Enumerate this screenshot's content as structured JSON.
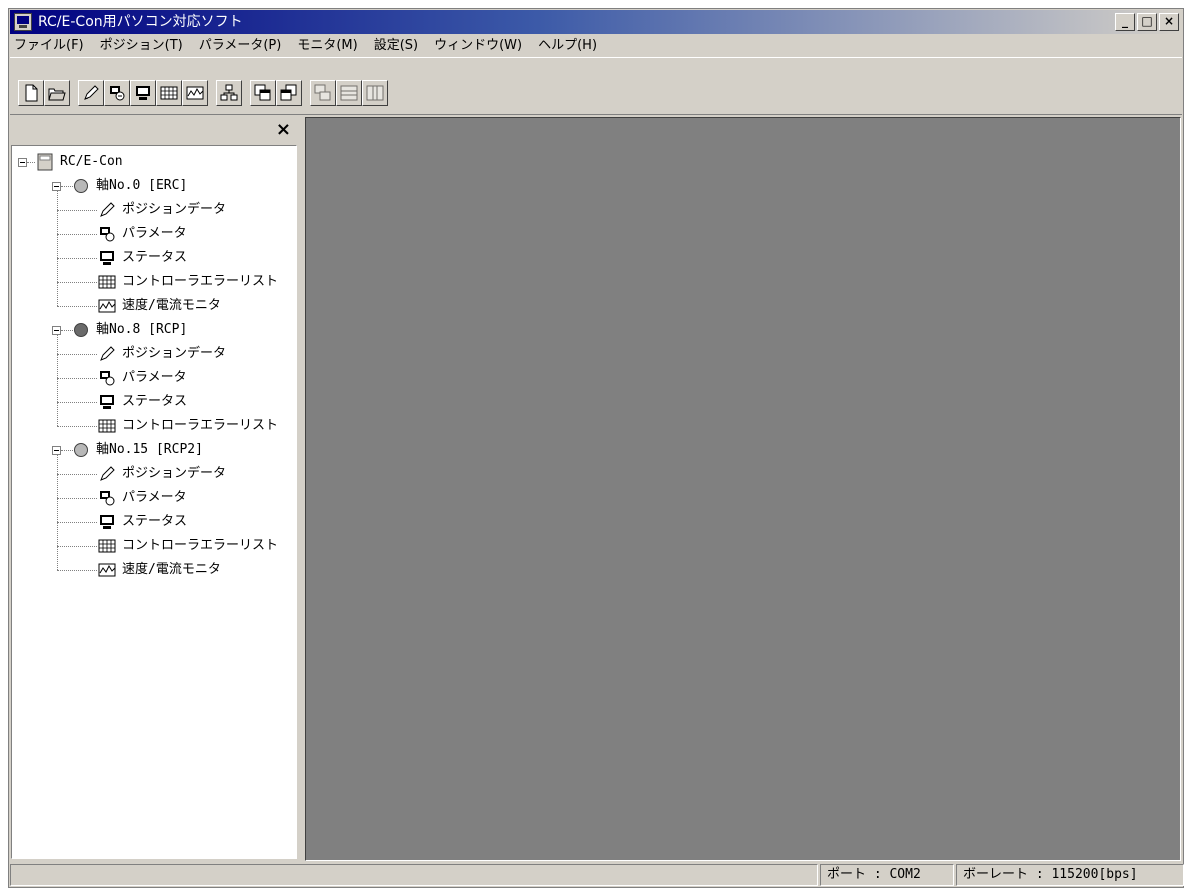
{
  "window": {
    "title": "RC/E-Con用パソコン対応ソフト",
    "min_glyph": "_",
    "max_glyph": "□",
    "close_glyph": "×"
  },
  "menu": [
    "ファイル(F)",
    "ポジション(T)",
    "パラメータ(P)",
    "モニタ(M)",
    "設定(S)",
    "ウィンドウ(W)",
    "ヘルプ(H)"
  ],
  "toolbar": {
    "buttons": [
      {
        "name": "new-file-icon",
        "enabled": true
      },
      {
        "name": "open-folder-icon",
        "enabled": true
      },
      {
        "name": "pencil-icon",
        "enabled": true
      },
      {
        "name": "parameter-icon",
        "enabled": true
      },
      {
        "name": "monitor-icon",
        "enabled": true
      },
      {
        "name": "error-list-icon",
        "enabled": true
      },
      {
        "name": "chart-icon",
        "enabled": true
      },
      {
        "name": "network-icon",
        "enabled": true
      },
      {
        "name": "copy-window-icon",
        "enabled": true
      },
      {
        "name": "paste-window-icon",
        "enabled": true
      },
      {
        "name": "cascade-icon",
        "enabled": false
      },
      {
        "name": "tile-horizontal-icon",
        "enabled": false
      },
      {
        "name": "tile-vertical-icon",
        "enabled": false
      }
    ]
  },
  "tree": {
    "close_glyph": "×",
    "root": "RC/E-Con",
    "axes": [
      {
        "label": "軸No.0 [ERC]",
        "color": "#b8b8b8",
        "children": [
          "ポジションデータ",
          "パラメータ",
          "ステータス",
          "コントローラエラーリスト",
          "速度/電流モニタ"
        ]
      },
      {
        "label": "軸No.8 [RCP]",
        "color": "#6a6a6a",
        "children": [
          "ポジションデータ",
          "パラメータ",
          "ステータス",
          "コントローラエラーリスト"
        ]
      },
      {
        "label": "軸No.15 [RCP2]",
        "color": "#b8b8b8",
        "children": [
          "ポジションデータ",
          "パラメータ",
          "ステータス",
          "コントローラエラーリスト",
          "速度/電流モニタ"
        ]
      }
    ]
  },
  "status": {
    "port": "ポート : COM2",
    "baud": "ボーレート : 115200[bps]"
  }
}
